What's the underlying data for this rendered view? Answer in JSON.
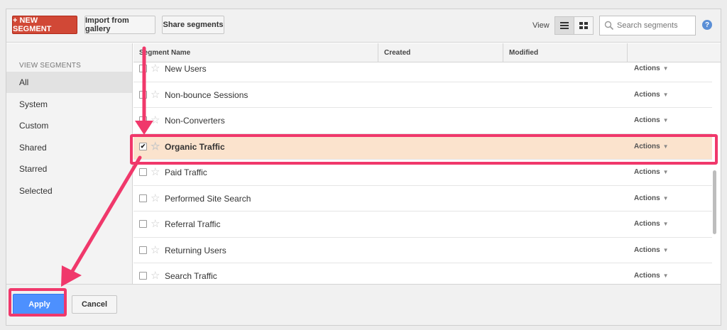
{
  "toolbar": {
    "new_segment_label": "+ NEW SEGMENT",
    "import_label": "Import from gallery",
    "share_label": "Share segments",
    "view_label": "View",
    "list_view_icon": "list-view-icon",
    "grid_view_icon": "grid-view-icon",
    "search_placeholder": "Search segments",
    "help_label": "?"
  },
  "sidebar": {
    "heading": "VIEW SEGMENTS",
    "items": [
      {
        "label": "All",
        "active": true
      },
      {
        "label": "System",
        "active": false
      },
      {
        "label": "Custom",
        "active": false
      },
      {
        "label": "Shared",
        "active": false
      },
      {
        "label": "Starred",
        "active": false
      },
      {
        "label": "Selected",
        "active": false
      }
    ]
  },
  "table": {
    "columns": [
      "Segment Name",
      "Created",
      "Modified"
    ],
    "rows": [
      {
        "name": "New Users",
        "checked": false,
        "action": "Actions"
      },
      {
        "name": "Non-bounce Sessions",
        "checked": false,
        "action": "Actions"
      },
      {
        "name": "Non-Converters",
        "checked": false,
        "action": "Actions"
      },
      {
        "name": "Organic Traffic",
        "checked": true,
        "action": "Actions"
      },
      {
        "name": "Paid Traffic",
        "checked": false,
        "action": "Actions"
      },
      {
        "name": "Performed Site Search",
        "checked": false,
        "action": "Actions"
      },
      {
        "name": "Referral Traffic",
        "checked": false,
        "action": "Actions"
      },
      {
        "name": "Returning Users",
        "checked": false,
        "action": "Actions"
      },
      {
        "name": "Search Traffic",
        "checked": false,
        "action": "Actions"
      }
    ]
  },
  "footer": {
    "apply_label": "Apply",
    "cancel_label": "Cancel"
  },
  "colors": {
    "new_segment_red": "#d14836",
    "apply_blue": "#4d90fe",
    "selected_row": "#fbe3cd",
    "annotation_pink": "#f0386b"
  }
}
